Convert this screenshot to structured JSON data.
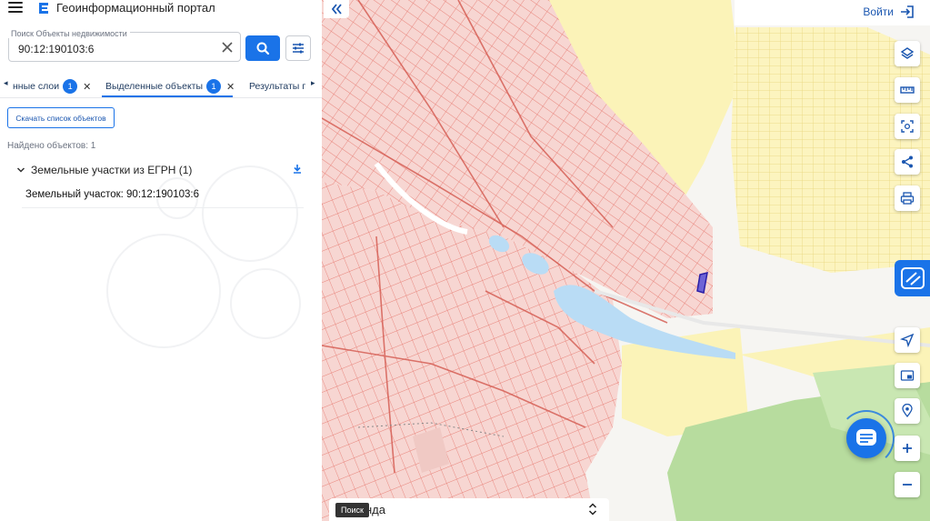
{
  "header": {
    "app_title": "Геоинформационный портал"
  },
  "search": {
    "label": "Поиск Объекты недвижимости",
    "value": "90:12:190103:6"
  },
  "tabs": [
    {
      "label": "нные слои",
      "count": "1"
    },
    {
      "label": "Выделенные объекты",
      "count": "1"
    },
    {
      "label": "Результаты по"
    }
  ],
  "results": {
    "download_label": "Скачать список объектов",
    "found_text": "Найдено объектов: 1",
    "group_title": "Земельные участки из ЕГРН (1)",
    "items": [
      {
        "label": "Земельный участок: 90:12:190103:6"
      }
    ]
  },
  "map": {
    "login_label": "Войти",
    "legend_text": "нда",
    "tooltip_text": "Поиск",
    "tools": [
      "layers-icon",
      "ruler-icon",
      "select-area-icon",
      "share-icon",
      "print-icon",
      "locate-icon",
      "minimap-icon",
      "pin-icon",
      "zoom-in-icon",
      "zoom-out-icon"
    ]
  },
  "colors": {
    "accent": "#1a73e8",
    "parcel_fill": "#f7d3d0",
    "parcel_stroke": "#e8837a",
    "zone_yellow": "#fbf3b8",
    "water": "#b9dcf5",
    "green": "#b7dc9e",
    "selected_parcel": "#3a2fb0"
  }
}
